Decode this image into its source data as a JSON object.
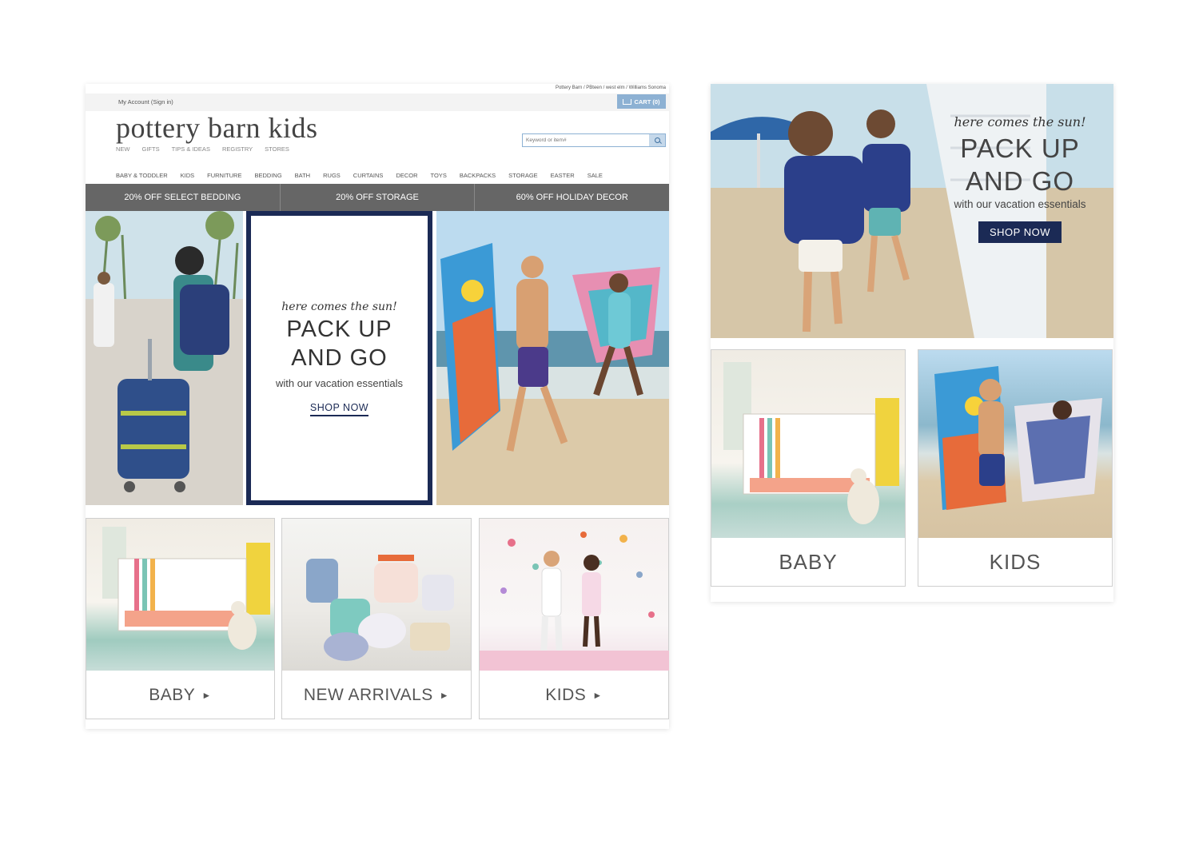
{
  "desktop": {
    "utility_links": "Pottery Barn / PBteen / west elm / Williams Sonoma",
    "account_link": "My Account (Sign in)",
    "cart_label": "CART (0)",
    "logo": "pottery barn kids",
    "subnav": [
      "NEW",
      "GIFTS",
      "TIPS & IDEAS",
      "REGISTRY",
      "STORES"
    ],
    "search_placeholder": "Keyword or item#",
    "mainnav": [
      "BABY & TODDLER",
      "KIDS",
      "FURNITURE",
      "BEDDING",
      "BATH",
      "RUGS",
      "CURTAINS",
      "DECOR",
      "TOYS",
      "BACKPACKS",
      "STORAGE",
      "EASTER",
      "SALE"
    ],
    "promos": [
      "20% OFF SELECT BEDDING",
      "20% OFF STORAGE",
      "60% OFF HOLIDAY DECOR"
    ],
    "hero": {
      "script": "here comes the sun!",
      "line1": "PACK UP",
      "line2": "AND GO",
      "subtitle": "with our vacation essentials",
      "cta": "SHOP NOW"
    },
    "tiles": [
      {
        "label": "BABY"
      },
      {
        "label": "NEW ARRIVALS"
      },
      {
        "label": "KIDS"
      }
    ]
  },
  "mobile": {
    "hero": {
      "script": "here comes the sun!",
      "line1": "PACK UP",
      "line2": "AND GO",
      "subtitle": "with our vacation essentials",
      "cta": "SHOP NOW"
    },
    "tiles": [
      {
        "label": "BABY"
      },
      {
        "label": "KIDS"
      }
    ]
  },
  "colors": {
    "navy": "#1b2a55",
    "promo_bar": "#666666",
    "cart": "#8db1d3"
  }
}
